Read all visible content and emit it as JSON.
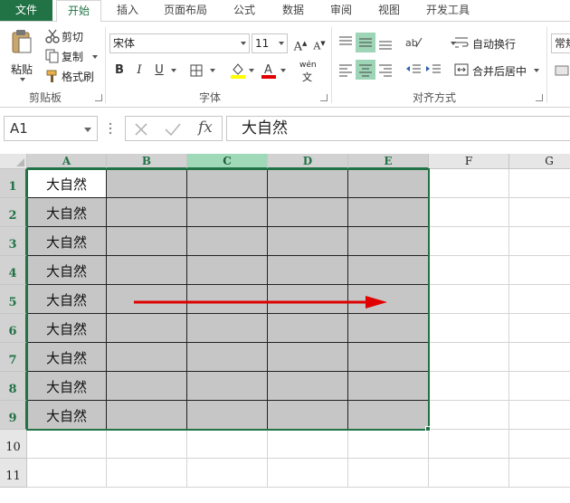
{
  "tabs": [
    {
      "label": "文件"
    },
    {
      "label": "开始"
    },
    {
      "label": "插入"
    },
    {
      "label": "页面布局"
    },
    {
      "label": "公式"
    },
    {
      "label": "数据"
    },
    {
      "label": "审阅"
    },
    {
      "label": "视图"
    },
    {
      "label": "开发工具"
    }
  ],
  "ribbon": {
    "clipboard": {
      "paste": "粘贴",
      "cut": "剪切",
      "copy": "复制",
      "format_painter": "格式刷",
      "group_label": "剪贴板"
    },
    "font": {
      "font_name": "宋体",
      "font_size": "11",
      "bold": "B",
      "italic": "I",
      "underline": "U",
      "phonetic": "wén",
      "group_label": "字体"
    },
    "alignment": {
      "wrap_text": "自动换行",
      "merge_center": "合并后居中",
      "group_label": "对齐方式"
    },
    "number": {
      "format": "常规"
    }
  },
  "formula_bar": {
    "name_box": "A1",
    "fx": "fx",
    "content": "大自然"
  },
  "grid": {
    "columns": [
      "A",
      "B",
      "C",
      "D",
      "E",
      "F",
      "G"
    ],
    "rows": [
      "1",
      "2",
      "3",
      "4",
      "5",
      "6",
      "7",
      "8",
      "9",
      "10",
      "11"
    ],
    "a_values": [
      "大自然",
      "大自然",
      "大自然",
      "大自然",
      "大自然",
      "大自然",
      "大自然",
      "大自然",
      "大自然"
    ],
    "active_cell": "A1",
    "selection": "A1:E9"
  },
  "colors": {
    "accent": "#217346",
    "selection_fill": "#c6c6c6",
    "arrow": "#e00000"
  }
}
